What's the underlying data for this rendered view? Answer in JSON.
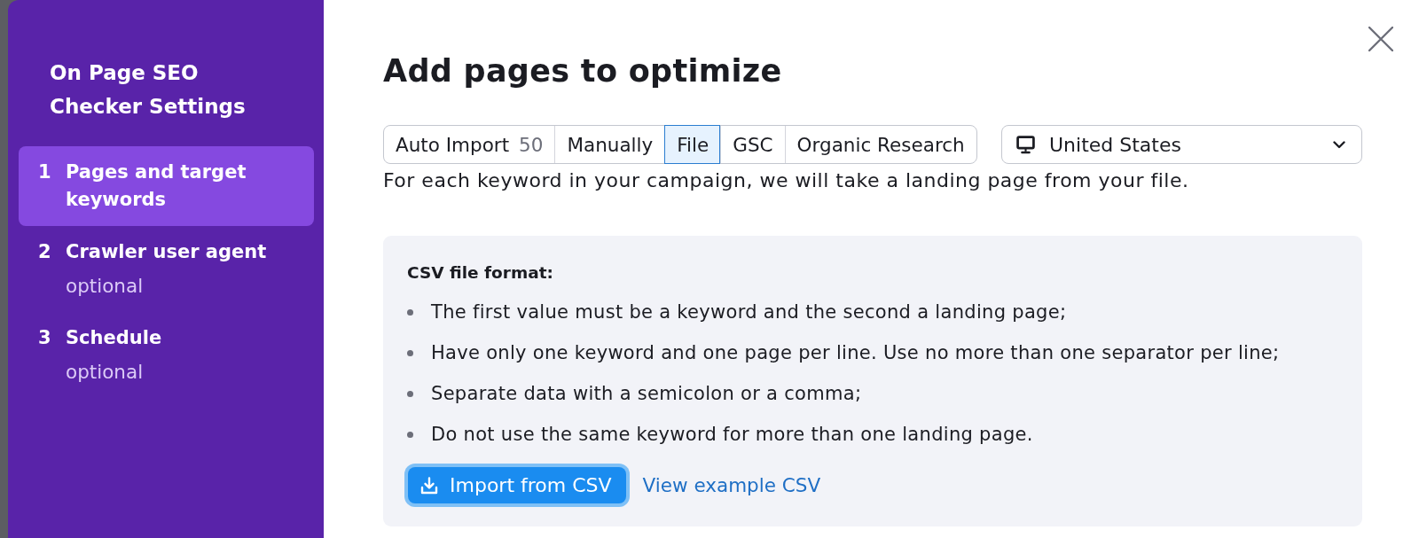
{
  "sidebar": {
    "title": "On Page SEO Checker Settings",
    "steps": [
      {
        "number": "1",
        "label": "Pages and target keywords",
        "selected": true
      },
      {
        "number": "2",
        "label": "Crawler user agent",
        "note": "optional",
        "selected": false
      },
      {
        "number": "3",
        "label": "Schedule",
        "note": "optional",
        "selected": false
      }
    ]
  },
  "dialog": {
    "title": "Add pages to optimize"
  },
  "tabs": [
    {
      "label": "Auto Import",
      "count": "50",
      "selected": false
    },
    {
      "label": "Manually",
      "selected": false
    },
    {
      "label": "File",
      "selected": true
    },
    {
      "label": "GSC",
      "selected": false
    },
    {
      "label": "Organic Research",
      "selected": false
    }
  ],
  "location_select": {
    "value": "United States"
  },
  "description": "For each keyword in your campaign, we will take a landing page from your file.",
  "format_box": {
    "heading": "CSV file format:",
    "rules": [
      "The first value must be a keyword and the second a landing page;",
      "Have only one keyword and one page per line. Use no more than one separator per line;",
      "Separate data with a semicolon or a comma;",
      "Do not use the same keyword for more than one landing page."
    ]
  },
  "import_button": {
    "label": "Import from CSV",
    "focused": true
  },
  "example_link": {
    "label": "View example CSV"
  }
}
